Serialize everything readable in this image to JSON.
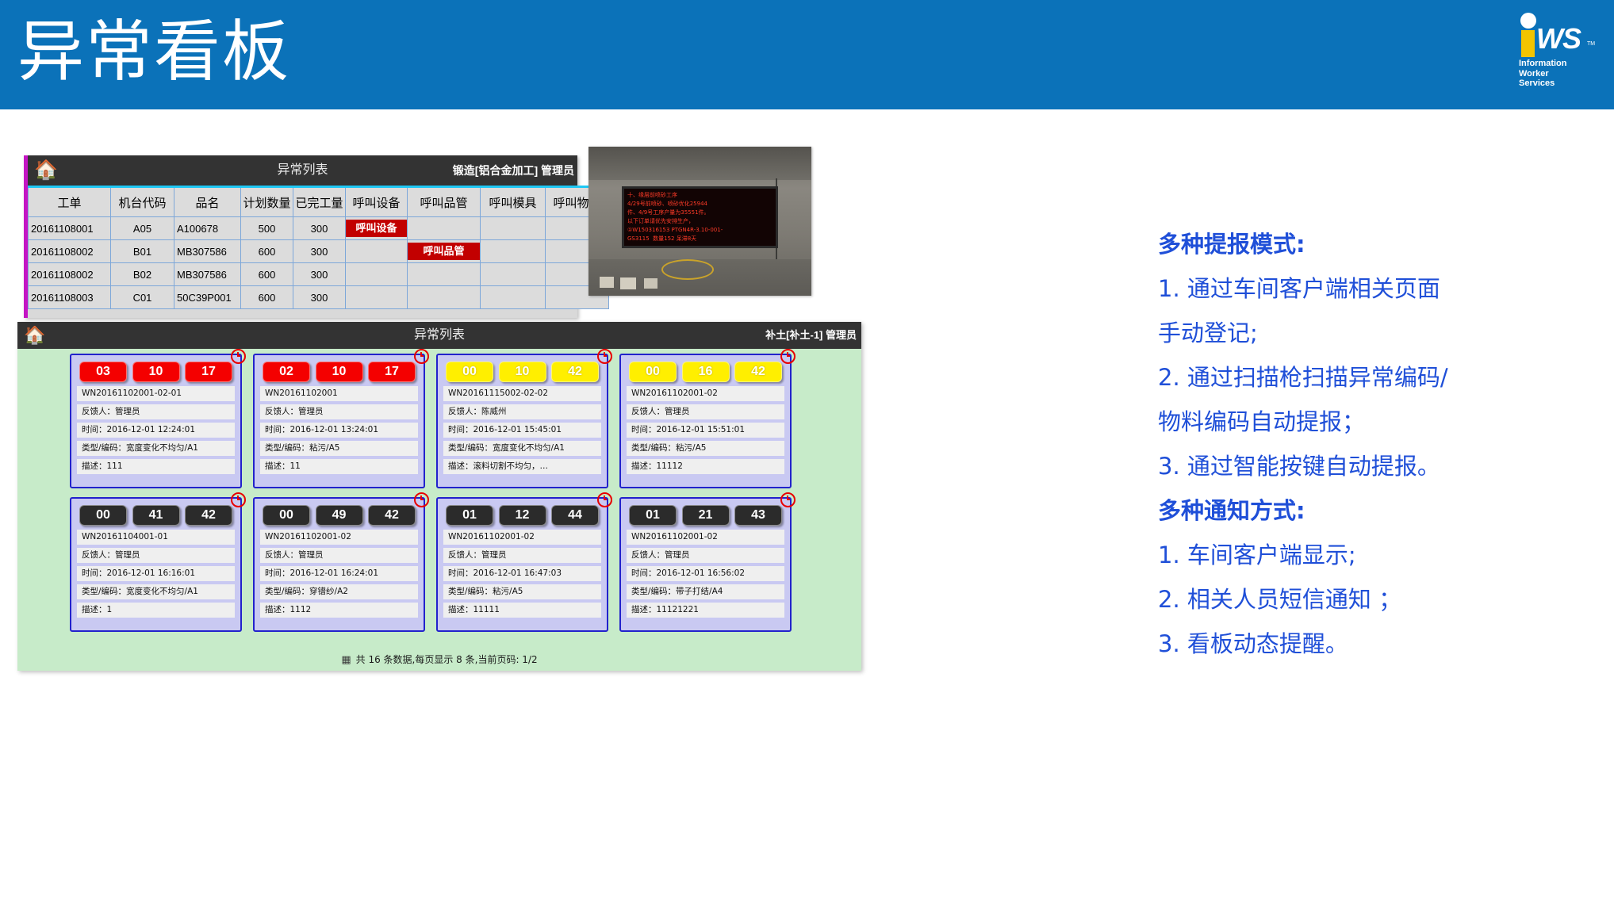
{
  "header": {
    "title": "异常看板",
    "logo": {
      "i": "i",
      "ws": "WS",
      "tm": "TM",
      "sub": "Information\nWorker\nServices"
    }
  },
  "panel_list": {
    "home_icon": "home-icon",
    "title": "异常列表",
    "context": "锻造[铝合金加工]  管理员",
    "columns": [
      "工单",
      "机台代码",
      "品名",
      "计划数量",
      "已完工量",
      "呼叫设备",
      "呼叫品管",
      "呼叫模具",
      "呼叫物料"
    ],
    "rows": [
      {
        "wo": "20161108001",
        "machine": "A05",
        "product": "A100678",
        "plan": "500",
        "done": "300",
        "call_equip": "呼叫设备",
        "call_qa": "",
        "call_mold": "",
        "call_mat": ""
      },
      {
        "wo": "20161108002",
        "machine": "B01",
        "product": "MB307586",
        "plan": "600",
        "done": "300",
        "call_equip": "",
        "call_qa": "呼叫品管",
        "call_mold": "",
        "call_mat": ""
      },
      {
        "wo": "20161108002",
        "machine": "B02",
        "product": "MB307586",
        "plan": "600",
        "done": "300",
        "call_equip": "",
        "call_qa": "",
        "call_mold": "",
        "call_mat": ""
      },
      {
        "wo": "20161108003",
        "machine": "C01",
        "product": "50C39P001",
        "plan": "600",
        "done": "300",
        "call_equip": "",
        "call_qa": "",
        "call_mold": "",
        "call_mat": ""
      }
    ]
  },
  "photo": {
    "led_text": "十、缘层前喷砂工序\n4/29号前喷砂、喷砂优化25944\n件、4/9号工序产量为35551件。\n以下订单请优先安排生产，\n①W150316153 PTGN4R-3.10-001-\nGS3115  数量152 呆滞8天"
  },
  "panel_kanban": {
    "home_icon": "home-icon",
    "title": "异常列表",
    "context": "补土[补土-1]   管理员",
    "cards": [
      {
        "badges": [
          "03",
          "10",
          "17"
        ],
        "color": "red",
        "wo": "WN20161102001-02-01",
        "reporter": "反馈人：管理员",
        "time": "时间：2016-12-01 12:24:01",
        "type": "类型/编码：宽度变化不均匀/A1",
        "desc": "描述：111"
      },
      {
        "badges": [
          "02",
          "10",
          "17"
        ],
        "color": "red",
        "wo": "WN20161102001",
        "reporter": "反馈人：管理员",
        "time": "时间：2016-12-01 13:24:01",
        "type": "类型/编码：粘污/A5",
        "desc": "描述：11"
      },
      {
        "badges": [
          "00",
          "10",
          "42"
        ],
        "color": "yellow",
        "wo": "WN20161115002-02-02",
        "reporter": "反馈人：陈威州",
        "time": "时间：2016-12-01 15:45:01",
        "type": "类型/编码：宽度变化不均匀/A1",
        "desc": "描述：滚料切割不均匀，…"
      },
      {
        "badges": [
          "00",
          "16",
          "42"
        ],
        "color": "yellow",
        "wo": "WN20161102001-02",
        "reporter": "反馈人：管理员",
        "time": "时间：2016-12-01 15:51:01",
        "type": "类型/编码：粘污/A5",
        "desc": "描述：11112"
      },
      {
        "badges": [
          "00",
          "41",
          "42"
        ],
        "color": "black",
        "wo": "WN20161104001-01",
        "reporter": "反馈人：管理员",
        "time": "时间：2016-12-01 16:16:01",
        "type": "类型/编码：宽度变化不均匀/A1",
        "desc": "描述：1"
      },
      {
        "badges": [
          "00",
          "49",
          "42"
        ],
        "color": "black",
        "wo": "WN20161102001-02",
        "reporter": "反馈人：管理员",
        "time": "时间：2016-12-01 16:24:01",
        "type": "类型/编码：穿镨纱/A2",
        "desc": "描述：1112"
      },
      {
        "badges": [
          "01",
          "12",
          "44"
        ],
        "color": "black",
        "wo": "WN20161102001-02",
        "reporter": "反馈人：管理员",
        "time": "时间：2016-12-01 16:47:03",
        "type": "类型/编码：粘污/A5",
        "desc": "描述：11111"
      },
      {
        "badges": [
          "01",
          "21",
          "43"
        ],
        "color": "black",
        "wo": "WN20161102001-02",
        "reporter": "反馈人：管理员",
        "time": "时间：2016-12-01 16:56:02",
        "type": "类型/编码：带子打结/A4",
        "desc": "描述：11121221"
      }
    ],
    "footer_icon": "grid-icon",
    "footer": "共  16  条数据,每页显示  8  条,当前页码:     1/2"
  },
  "right_text": {
    "h1": "多种提报模式:",
    "l1": "1. 通过车间客户端相关页面",
    "l2": "手动登记;",
    "l3": "2. 通过扫描枪扫描异常编码/",
    "l4": "物料编码自动提报；",
    "l5": "3. 通过智能按键自动提报。",
    "h2": "多种通知方式:",
    "l6": "1. 车间客户端显示;",
    "l7": "2. 相关人员短信通知 ；",
    "l8": "3. 看板动态提醒。"
  },
  "colors": {
    "header_blue": "#0b72b9",
    "text_blue": "#1f4fd8",
    "badge_red": "#f40000",
    "badge_yellow": "#ffef00",
    "badge_black": "#2b2b2b",
    "kanban_bg": "#c7ebc9",
    "card_bg": "#c9c9f2",
    "call_red": "#c20000"
  }
}
